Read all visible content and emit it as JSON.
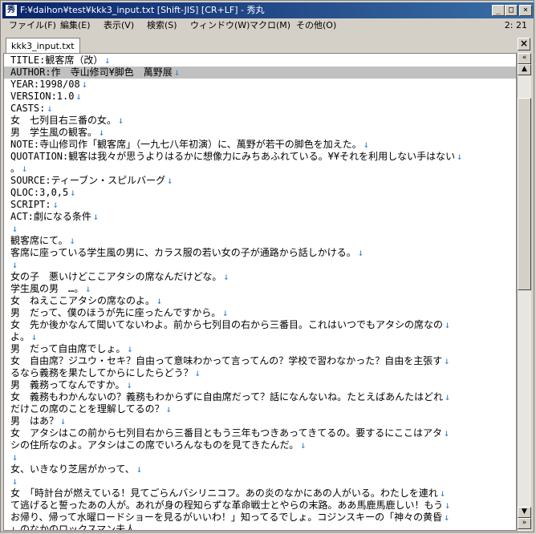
{
  "window": {
    "title": "F:¥daihon¥test¥kkk3_input.txt  [Shift-JIS] [CR+LF] - 秀丸"
  },
  "menubar": {
    "items": [
      "ファイル(F)",
      "編集(E)",
      "表示(V)",
      "検索(S)",
      "ウィンドウ(W)",
      "マクロ(M)",
      "その他(O)"
    ],
    "clock": "2: 21"
  },
  "tabs": [
    {
      "label": "kkk3_input.txt"
    }
  ],
  "editor": {
    "eol_glyph": "↓",
    "current_line": 1,
    "lines": [
      "TITLE:観客席（改）",
      "AUTHOR:作　寺山修司¥脚色　萬野展",
      "YEAR:1998/08",
      "VERSION:1.0",
      "CASTS:",
      "女　七列目右三番の女。",
      "男　学生風の観客。",
      "NOTE:寺山修司作「観客席」（一九七八年初演）に、萬野が若干の脚色を加えた。",
      "QUOTATION:観客は我々が思うよりはるかに想像力にみちあふれている。¥¥それを利用しない手はない",
      "。",
      "SOURCE:ティーブン・スピルバーグ",
      "QLOC:3,0,5",
      "SCRIPT:",
      "ACT:劇になる条件",
      "",
      "観客席にて。",
      "客席に座っている学生風の男に、カラス服の若い女の子が通路から話しかける。",
      "",
      "女の子　悪いけどここアタシの席なんだけどな。",
      "学生風の男　…。",
      "女　ねえここアタシの席なのよ。",
      "男　だって、僕のほうが先に座ったんですから。",
      "女　先か後かなんて聞いてないわよ。前から七列目の右から三番目。これはいつでもアタシの席なの",
      "よ。",
      "男　だって自由席でしょ。",
      "女　自由席？ジユウ・セキ？自由って意味わかって言ってんの？学校で習わなかった？自由を主張す",
      "るなら義務を果たしてからにしたらどう？",
      "男　義務ってなんですか。",
      "女　義務もわかんないの？義務もわからずに自由席だって？話になんないね。たとえばあんたはどれ",
      "だけこの席のことを理解してるの？",
      "男　はあ？",
      "女　アタシはこの前から七列目右から三番目ともう三年もつきあってきてるの。要するにここはアタ",
      "シの住所なのよ。アタシはこの席でいろんなものを見てきたんだ。",
      "",
      "女、いきなり芝居がかって、",
      "",
      "女　「時計台が燃えている！見てごらんバシリニコフ。あの炎のなかにあの人がいる。わたしを連れ",
      "て逃げると誓ったあの人が。あれが身の程知らずな革命戦士とやらの末路。ああ馬鹿馬鹿しい！もう",
      "お帰り、帰って水曜ロードショーを見るがいいわ！」知ってるでしょ。コジンスキーの「神々の黄昏",
      "」のなかのロックスマン夫人"
    ]
  }
}
